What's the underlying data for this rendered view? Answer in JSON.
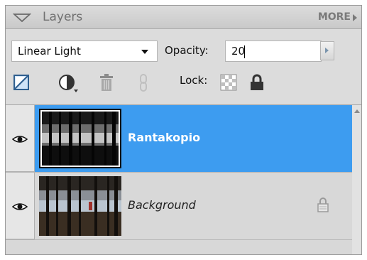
{
  "panel": {
    "title": "Layers",
    "more_label": "MORE",
    "icons": {
      "collapse": "triangle-down-icon",
      "more": "triangle-right-icon"
    }
  },
  "controls": {
    "blend_mode": "Linear Light",
    "opacity_label": "Opacity:",
    "opacity_value": "20",
    "lock_label": "Lock:",
    "tools": [
      "new-layer-icon",
      "adjustment-layer-icon",
      "trash-icon",
      "link-icon",
      "lock-transparency-icon",
      "lock-all-icon"
    ]
  },
  "layers": [
    {
      "name": "Rantakopio",
      "visible": true,
      "selected": true,
      "locked": false
    },
    {
      "name": "Background",
      "visible": true,
      "selected": false,
      "locked": true
    }
  ],
  "colors": {
    "selection": "#3d9cf0",
    "panel_bg": "#d8d8d8"
  }
}
